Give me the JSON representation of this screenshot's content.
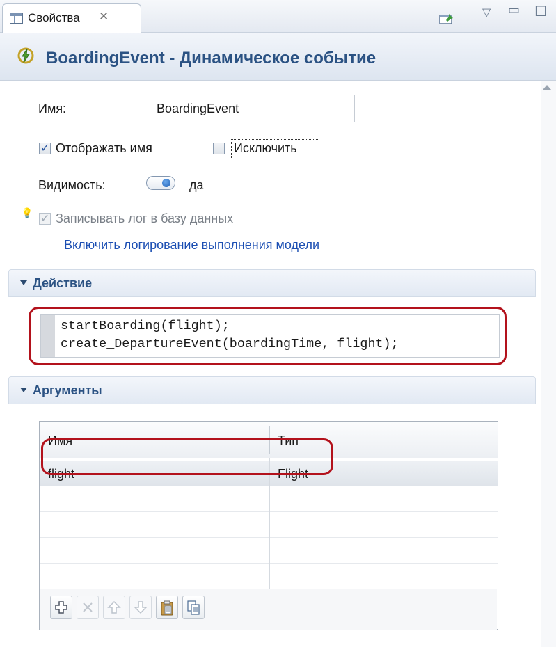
{
  "tab": {
    "title": "Свойства",
    "close_glyph": "✕"
  },
  "header": {
    "title": "BoardingEvent - Динамическое событие",
    "icon": "bolt-icon"
  },
  "general": {
    "name_label": "Имя:",
    "name_value": "BoardingEvent",
    "show_name_label": "Отображать имя",
    "show_name_checked": true,
    "exclude_label": "Исключить",
    "exclude_checked": false,
    "visibility_label": "Видимость:",
    "visibility_value": "да",
    "log_label": "Записывать лог в базу данных",
    "log_checked": true,
    "log_enabled": false,
    "enable_logging_link": "Включить логирование выполнения модели"
  },
  "action": {
    "title": "Действие",
    "code_lines": [
      "startBoarding(flight);",
      "create_DepartureEvent(boardingTime, flight);"
    ]
  },
  "arguments": {
    "title": "Аргументы",
    "columns": [
      "Имя",
      "Тип"
    ],
    "rows": [
      {
        "name": "flight",
        "type": "Flight"
      }
    ],
    "toolbar": [
      "add-icon",
      "delete-icon",
      "move-up-icon",
      "move-down-icon",
      "paste-icon",
      "copy-icon"
    ]
  },
  "colors": {
    "accent_title": "#2b5283",
    "highlight": "#b3121c",
    "link": "#1c4fb3"
  }
}
